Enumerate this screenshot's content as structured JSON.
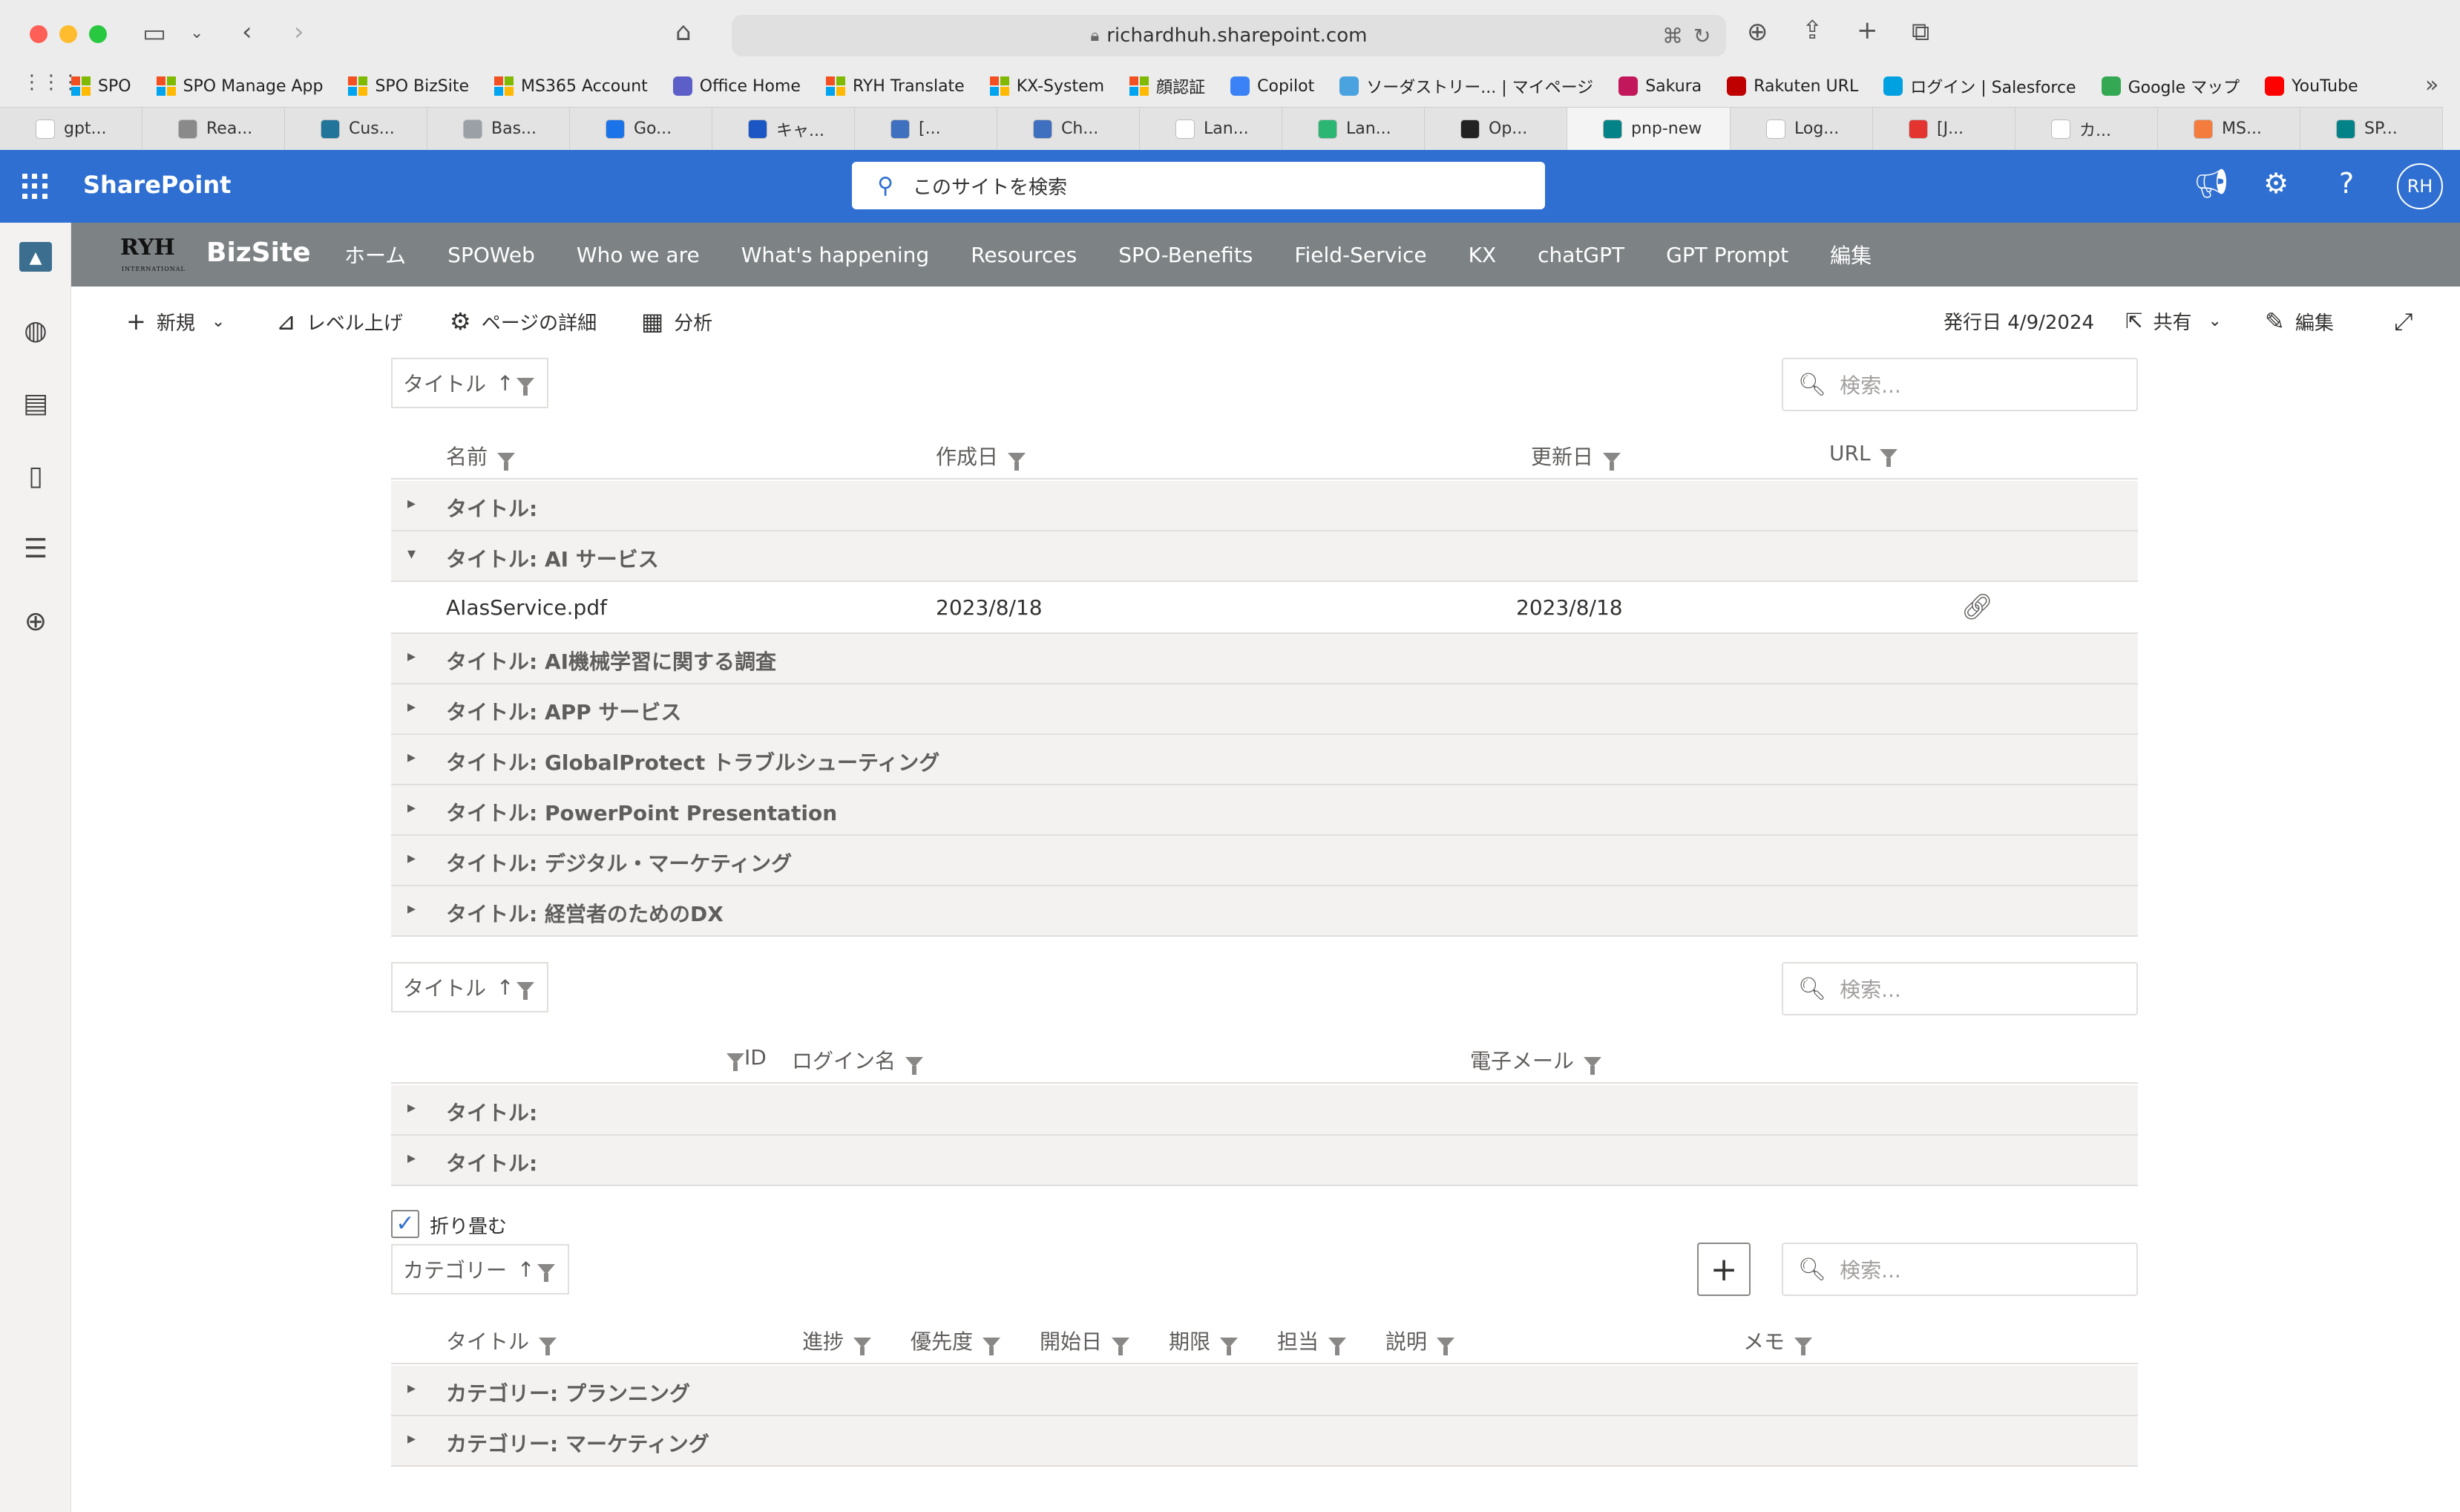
{
  "browser": {
    "url": "richardhuh.sharepoint.com",
    "bookmarks": [
      {
        "label": "SPO",
        "icon": "ms-logo-icon"
      },
      {
        "label": "SPO Manage App",
        "icon": "ms-logo-icon"
      },
      {
        "label": "SPO BizSite",
        "icon": "ms-logo-icon"
      },
      {
        "label": "MS365 Account",
        "icon": "ms-logo-icon"
      },
      {
        "label": "Office Home",
        "icon": "office-icon"
      },
      {
        "label": "RYH Translate",
        "icon": "ms-logo-icon"
      },
      {
        "label": "KX-System",
        "icon": "ms-logo-icon"
      },
      {
        "label": "顔認証",
        "icon": "ms-logo-icon"
      },
      {
        "label": "Copilot",
        "icon": "copilot-icon"
      },
      {
        "label": "ソーダストリー... | マイページ",
        "icon": "soda-icon"
      },
      {
        "label": "Sakura",
        "icon": "sakura-icon"
      },
      {
        "label": "Rakuten URL",
        "icon": "rakuten-icon"
      },
      {
        "label": "ログイン | Salesforce",
        "icon": "salesforce-icon"
      },
      {
        "label": "Google マップ",
        "icon": "maps-icon"
      },
      {
        "label": "YouTube",
        "icon": "youtube-icon"
      }
    ],
    "tabs": [
      {
        "label": "gpt...",
        "color": "#ffffff"
      },
      {
        "label": "Rea...",
        "color": "#8a8a8a"
      },
      {
        "label": "Cus...",
        "color": "#21759b"
      },
      {
        "label": "Bas...",
        "color": "#9aa0a6"
      },
      {
        "label": "Go...",
        "color": "#1a73e8"
      },
      {
        "label": "キャ...",
        "color": "#1a56c4"
      },
      {
        "label": "[...",
        "color": "#3f6fbf"
      },
      {
        "label": "Ch...",
        "color": "#3f6fbf"
      },
      {
        "label": "Lan...",
        "color": "#ffffff"
      },
      {
        "label": "Lan...",
        "color": "#2bb673"
      },
      {
        "label": "Op...",
        "color": "#222222"
      },
      {
        "label": "pnp-new",
        "color": "#038387"
      },
      {
        "label": "Log...",
        "color": "#ffffff"
      },
      {
        "label": "[J...",
        "color": "#e3342f"
      },
      {
        "label": "カ...",
        "color": "#ffffff"
      },
      {
        "label": "MS...",
        "color": "#f47c3c"
      },
      {
        "label": "SP...",
        "color": "#038387"
      }
    ]
  },
  "suite": {
    "app_name": "SharePoint",
    "search_placeholder": "このサイトを検索",
    "avatar_initials": "RH",
    "accent": "#2f6fd1"
  },
  "site": {
    "logo_text": "RYH",
    "logo_sub": "INTERNATIONAL",
    "name": "BizSite",
    "nav": [
      "ホーム",
      "SPOWeb",
      "Who we are",
      "What's happening",
      "Resources",
      "SPO-Benefits",
      "Field-Service",
      "KX",
      "chatGPT",
      "GPT Prompt",
      "編集"
    ]
  },
  "command_bar": {
    "new": "新規",
    "promote": "レベル上げ",
    "page_details": "ページの詳細",
    "analytics": "分析",
    "published": "発行日 4/9/2024",
    "share": "共有",
    "edit": "編集"
  },
  "grid1": {
    "group_by": "タイトル",
    "search_placeholder": "検索...",
    "columns": [
      "名前",
      "作成日",
      "更新日",
      "URL"
    ],
    "groups": [
      {
        "label": "タイトル:",
        "expanded": false
      },
      {
        "label": "タイトル: AI サービス",
        "expanded": true,
        "rows": [
          {
            "name": "AIasService.pdf",
            "created": "2023/8/18",
            "modified": "2023/8/18"
          }
        ]
      },
      {
        "label": "タイトル: AI機械学習に関する調査",
        "expanded": false
      },
      {
        "label": "タイトル: APP サービス",
        "expanded": false
      },
      {
        "label": "タイトル: GlobalProtect トラブルシューティング",
        "expanded": false
      },
      {
        "label": "タイトル: PowerPoint Presentation",
        "expanded": false
      },
      {
        "label": "タイトル: デジタル・マーケティング",
        "expanded": false
      },
      {
        "label": "タイトル: 経営者のためのDX",
        "expanded": false
      }
    ]
  },
  "grid2": {
    "group_by": "タイトル",
    "search_placeholder": "検索...",
    "columns": [
      "ID",
      "ログイン名",
      "電子メール"
    ],
    "groups": [
      {
        "label": "タイトル:",
        "expanded": false
      },
      {
        "label": "タイトル:",
        "expanded": false
      }
    ]
  },
  "grid3": {
    "collapse_label": "折り畳む",
    "collapse_checked": true,
    "group_by": "カテゴリー",
    "search_placeholder": "検索...",
    "columns": [
      "タイトル",
      "進捗",
      "優先度",
      "開始日",
      "期限",
      "担当",
      "説明",
      "メモ"
    ],
    "groups": [
      {
        "label": "カテゴリー: プランニング",
        "expanded": false
      },
      {
        "label": "カテゴリー: マーケティング",
        "expanded": false
      }
    ]
  }
}
